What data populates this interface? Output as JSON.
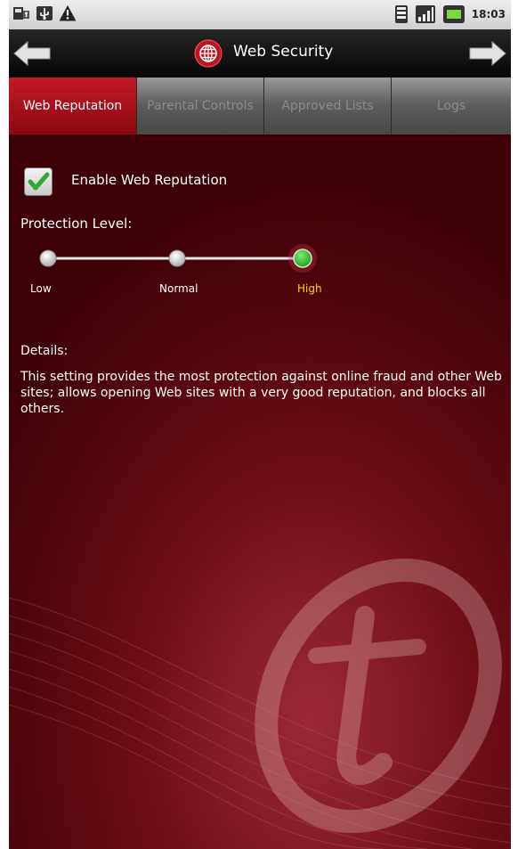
{
  "status_bar": {
    "time": "18:03",
    "left_icons": [
      "usb-debug-icon",
      "usb-icon",
      "warning-icon"
    ],
    "right_icons": [
      "wifi-icon",
      "signal-icon",
      "battery-icon"
    ]
  },
  "title_bar": {
    "title": "Web Security",
    "icon": "globe-icon"
  },
  "tabs": [
    {
      "label": "Web Reputation",
      "active": true
    },
    {
      "label": "Parental Controls",
      "active": false
    },
    {
      "label": "Approved Lists",
      "active": false
    },
    {
      "label": "Logs",
      "active": false
    }
  ],
  "settings": {
    "enable_label": "Enable Web Reputation",
    "enabled": true,
    "protection_label": "Protection Level:",
    "levels": [
      "Low",
      "Normal",
      "High"
    ],
    "selected_level": "High"
  },
  "details": {
    "label": "Details:",
    "text": "This setting provides the most protection against online fraud and other Web sites; allows opening Web sites with a very good reputation, and blocks all others."
  },
  "colors": {
    "background": "#3e0007",
    "active_tab": "#b0101a",
    "selected_level": "#ffd400",
    "slider_selected": "#2fb52b"
  }
}
